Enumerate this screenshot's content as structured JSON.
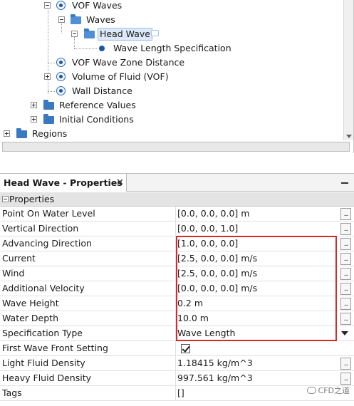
{
  "tree": {
    "items": [
      {
        "label": "VOF Waves"
      },
      {
        "label": "Waves"
      },
      {
        "label": "Head Wave"
      },
      {
        "label": "Wave Length Specification"
      },
      {
        "label": "VOF Wave Zone Distance"
      },
      {
        "label": "Volume of Fluid (VOF)"
      },
      {
        "label": "Wall Distance"
      },
      {
        "label": "Reference Values"
      },
      {
        "label": "Initial Conditions"
      },
      {
        "label": "Regions"
      }
    ]
  },
  "properties_panel": {
    "tab_title": "Head Wave - Properties",
    "close_glyph": "✕",
    "section_title": "Properties",
    "ellipsis": "...",
    "rows": [
      {
        "name": "Point On Water Level",
        "value": "[0.0, 0.0, 0.0] m"
      },
      {
        "name": "Vertical Direction",
        "value": "[0.0, 0.0, 1.0]"
      },
      {
        "name": "Advancing Direction",
        "value": "[1.0, 0.0, 0.0]"
      },
      {
        "name": "Current",
        "value": "[2.5, 0.0, 0.0] m/s"
      },
      {
        "name": "Wind",
        "value": "[2.5, 0.0, 0.0] m/s"
      },
      {
        "name": "Additional Velocity",
        "value": "[0.0, 0.0, 0.0] m/s"
      },
      {
        "name": "Wave Height",
        "value": "0.2 m"
      },
      {
        "name": "Water Depth",
        "value": "10.0 m"
      },
      {
        "name": "Specification Type",
        "value": "Wave Length"
      },
      {
        "name": "First Wave Front Setting",
        "value": "",
        "checked": true
      },
      {
        "name": "Light Fluid Density",
        "value": "1.18415 kg/m^3"
      },
      {
        "name": "Heavy Fluid Density",
        "value": "997.561 kg/m^3"
      },
      {
        "name": "Tags",
        "value": "[]"
      }
    ]
  },
  "watermark": {
    "text": "CFD之道"
  },
  "colors": {
    "highlight": "#d42a2a",
    "selection": "#dde9f8",
    "icon_blue": "#2a6cc0"
  }
}
